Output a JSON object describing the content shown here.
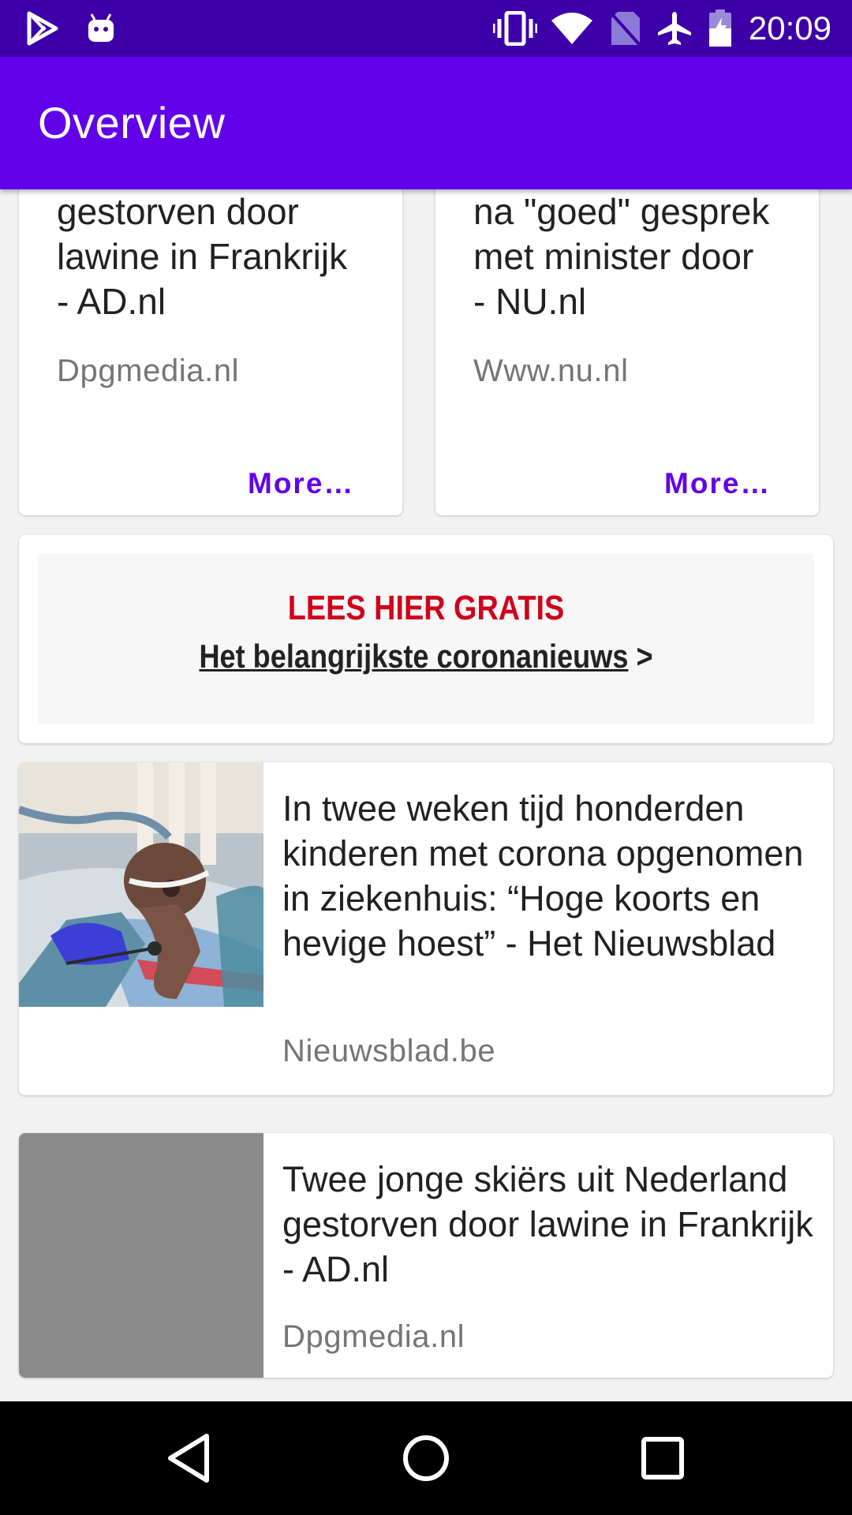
{
  "status_bar": {
    "time": "20:09",
    "left_icons": [
      "play-store-icon",
      "android-icon"
    ],
    "right_icons": [
      "vibrate-icon",
      "wifi-icon",
      "no-sim-icon",
      "airplane-mode-icon",
      "battery-charging-icon"
    ]
  },
  "app_bar": {
    "title": "Overview"
  },
  "cards_top": [
    {
      "title_lines": [
        "gestorven door",
        "lawine in Frankrijk",
        "- AD.nl"
      ],
      "source": "Dpgmedia.nl",
      "more_label": "More…"
    },
    {
      "title_lines": [
        "na \"goed\" gesprek",
        "met minister door",
        "- NU.nl"
      ],
      "source": "Www.nu.nl",
      "more_label": "More…"
    }
  ],
  "banner": {
    "headline": "LEES HIER GRATIS",
    "link_text": "Het belangrijkste coronanieuws",
    "arrow": " >"
  },
  "articles": [
    {
      "title": "In twee weken tijd honderden kinderen met corona opgenomen in ziekenhuis: “Hoge koorts en hevige hoest” - Het Nieuwsblad",
      "source": "Nieuwsblad.be",
      "has_image": true
    },
    {
      "title": "Twee jonge skiërs uit Nederland gestorven door lawine in Frankrijk - AD.nl",
      "source": "Dpgmedia.nl",
      "has_image": false
    }
  ],
  "nav_bar": {
    "icons": [
      "back-icon",
      "home-icon",
      "recents-icon"
    ]
  },
  "colors": {
    "status_bar": "#3d00a8",
    "app_bar": "#6200ea",
    "accent": "#6200ea",
    "banner_red": "#d0021b",
    "placeholder_gray": "#8a8a8a"
  }
}
